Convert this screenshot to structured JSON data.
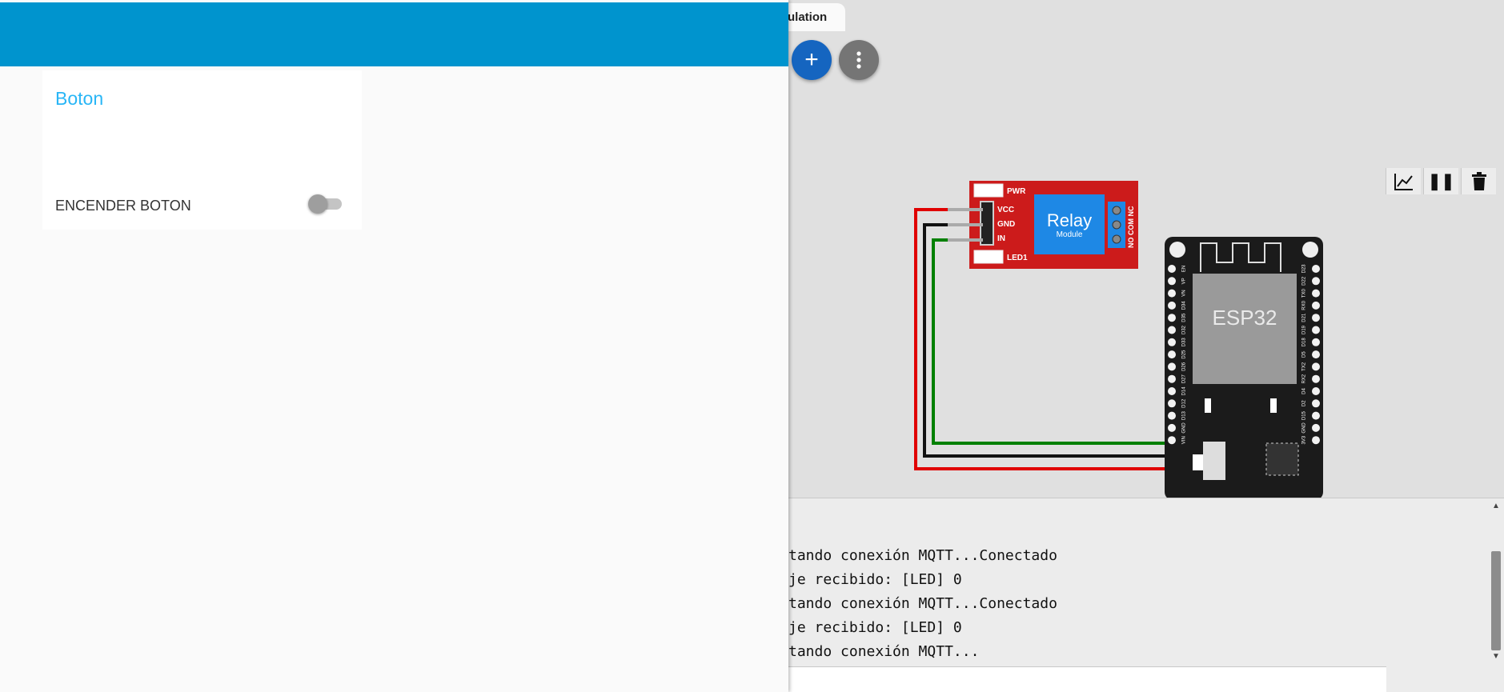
{
  "simulator": {
    "tab_label": "ulation",
    "relay": {
      "title": "Relay",
      "subtitle": "Module",
      "pins": [
        "VCC",
        "GND",
        "IN"
      ],
      "pwr_label": "PWR",
      "led_label": "LED1",
      "outputs": "NO COM NC"
    },
    "board": {
      "chip_label": "ESP32",
      "left_pins": [
        "EN",
        "VP",
        "VN",
        "D34",
        "D35",
        "D32",
        "D33",
        "D25",
        "D26",
        "D27",
        "D14",
        "D12",
        "D13",
        "GND",
        "VIN"
      ],
      "right_pins": [
        "D23",
        "D22",
        "TX0",
        "RX0",
        "D21",
        "D19",
        "D18",
        "D5",
        "TX2",
        "RX2",
        "D4",
        "D2",
        "D15",
        "GND",
        "3V3"
      ]
    },
    "wire_colors": {
      "power": "#e00000",
      "ground": "#111111",
      "signal": "#008000"
    },
    "serial": {
      "lines": [
        "tando conexión MQTT...Conectado",
        "je recibido: [LED] 0",
        "tando conexión MQTT...Conectado",
        "je recibido: [LED] 0",
        "tando conexión MQTT..."
      ]
    }
  },
  "dashboard": {
    "card_title": "Boton",
    "switch_label": "ENCENDER BOTON",
    "switch_on": false,
    "header_color": "#0094ce"
  }
}
